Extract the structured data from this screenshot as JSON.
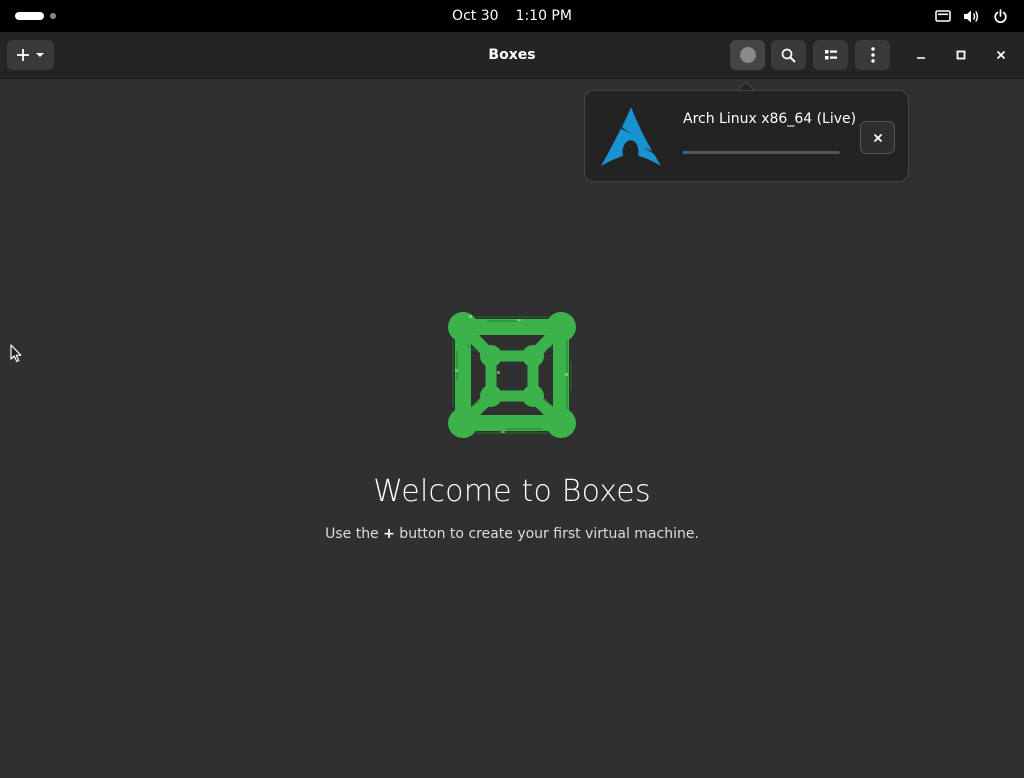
{
  "top_bar": {
    "date": "Oct 30",
    "time": "1:10 PM",
    "icons": [
      "activities-indicator",
      "display-icon",
      "volume-icon",
      "power-icon"
    ]
  },
  "header": {
    "title": "Boxes",
    "new_button_icon": "plus-icon",
    "buttons": [
      "downloads-indicator",
      "search-icon",
      "view-list-icon",
      "more-menu-icon"
    ],
    "window_controls": [
      "minimize-icon",
      "maximize-icon",
      "close-icon"
    ]
  },
  "downloads_popover": {
    "vm_name": "Arch Linux x86_64 (Live)",
    "progress": 0.02,
    "icon": "arch-linux-logo",
    "cancel_icon": "close-icon"
  },
  "welcome": {
    "title": "Welcome to Boxes",
    "subtitle_before": "Use the ",
    "subtitle_plus": "+",
    "subtitle_after": " button to create your first virtual machine.",
    "logo": "boxes-logo"
  },
  "colors": {
    "background": "#303030",
    "headerbar": "#242424",
    "accent": "#1c71d8",
    "arch_blue": "#1793d1",
    "boxes_green": "#3cb34a"
  }
}
